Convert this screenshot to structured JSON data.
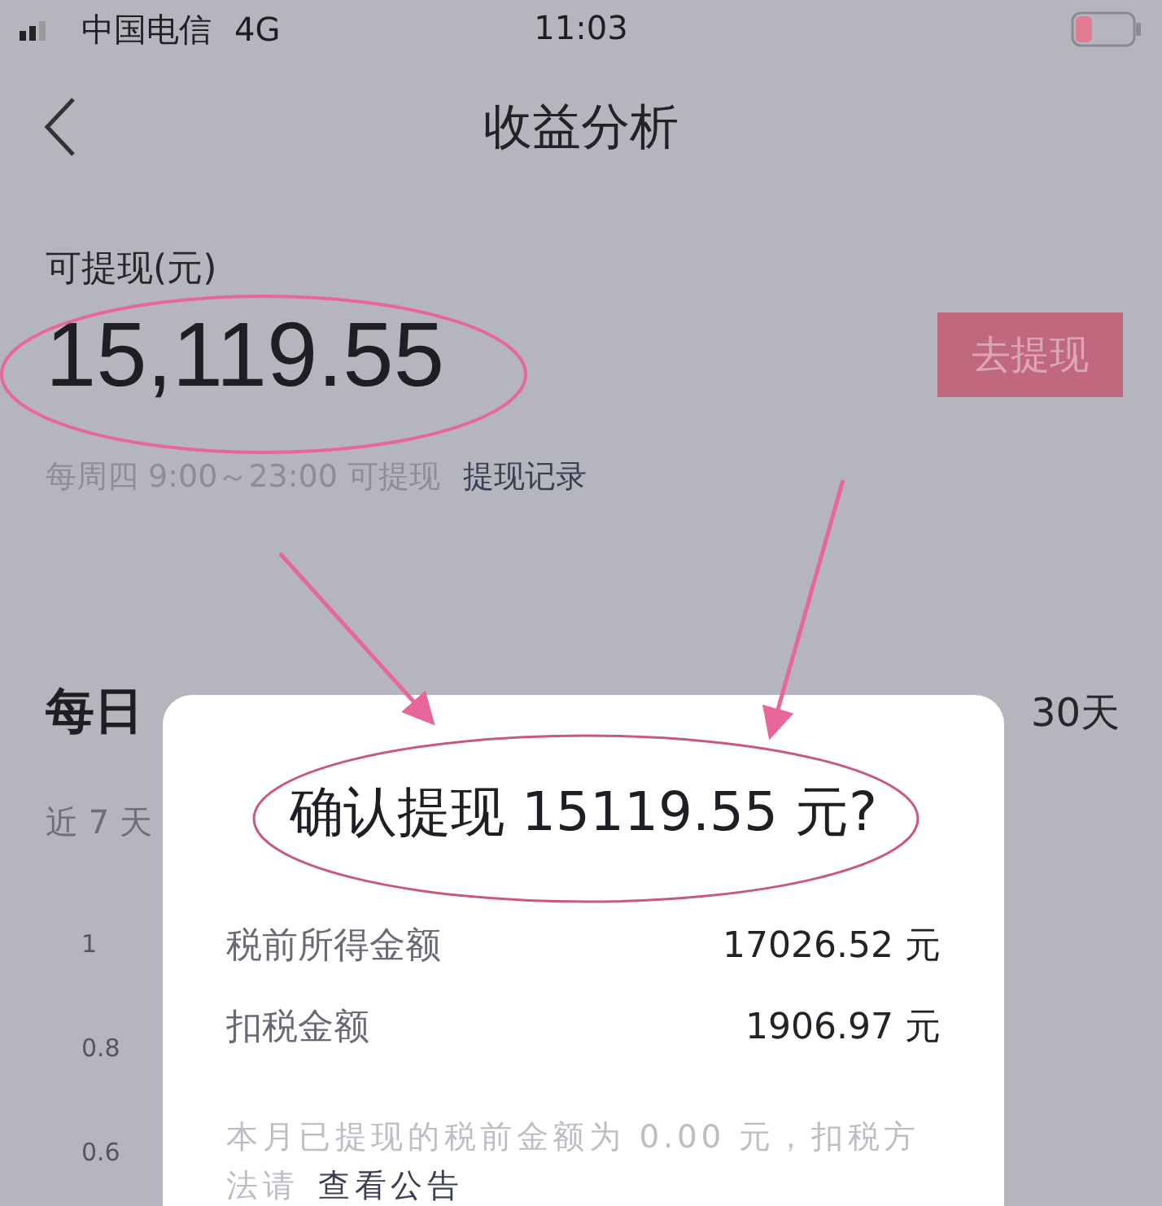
{
  "status_bar": {
    "carrier": "中国电信",
    "network": "4G",
    "time": "11:03"
  },
  "nav": {
    "title": "收益分析"
  },
  "balance": {
    "label": "可提现(元)",
    "amount": "15,119.55",
    "button": "去提现",
    "hint": "每周四 9:00～23:00 可提现",
    "link": "提现记录"
  },
  "daily": {
    "title": "每日",
    "range": "30天",
    "subtitle": "近 7 天",
    "axis_labels": [
      "1",
      "0.8",
      "0.6"
    ]
  },
  "dialog": {
    "title": "确认提现 15119.55 元?",
    "rows": [
      {
        "label": "税前所得金额",
        "value": "17026.52 元"
      },
      {
        "label": "扣税金额",
        "value": "1906.97 元"
      }
    ],
    "notice": "本月已提现的税前金额为 0.00 元，扣税方法请",
    "notice_link": "查看公告"
  }
}
